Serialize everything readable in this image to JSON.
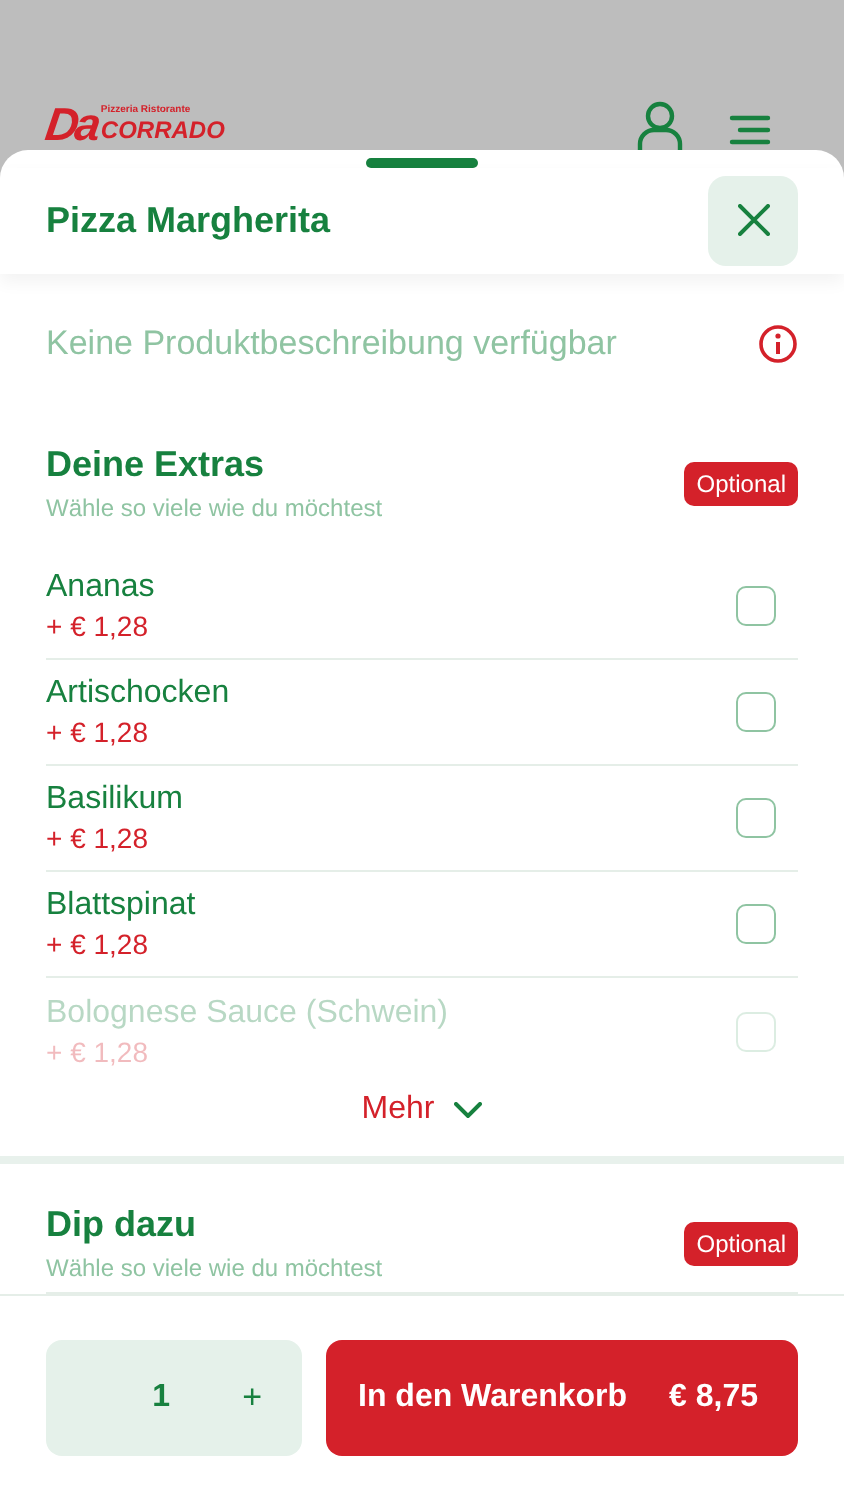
{
  "brand": {
    "mark": "Da",
    "tagline": "Pizzeria Ristorante",
    "name": "CORRADO"
  },
  "sheet": {
    "title": "Pizza Margherita",
    "description": "Keine Produktbeschreibung verfügbar"
  },
  "groups": [
    {
      "title": "Deine Extras",
      "subtitle": "Wähle so viele wie du möchtest",
      "badge": "Optional",
      "more": "Mehr",
      "options": [
        {
          "name": "Ananas",
          "price": "+ € 1,28",
          "checked": false,
          "faded": false
        },
        {
          "name": "Artischocken",
          "price": "+ € 1,28",
          "checked": false,
          "faded": false
        },
        {
          "name": "Basilikum",
          "price": "+ € 1,28",
          "checked": false,
          "faded": false
        },
        {
          "name": "Blattspinat",
          "price": "+ € 1,28",
          "checked": false,
          "faded": false
        },
        {
          "name": "Bolognese Sauce (Schwein)",
          "price": "+ € 1,28",
          "checked": false,
          "faded": true
        }
      ]
    },
    {
      "title": "Dip dazu",
      "subtitle": "Wähle so viele wie du möchtest",
      "badge": "Optional"
    }
  ],
  "footer": {
    "quantity": "1",
    "plus": "+",
    "cart_label": "In den Warenkorb",
    "total": "€ 8,75"
  }
}
